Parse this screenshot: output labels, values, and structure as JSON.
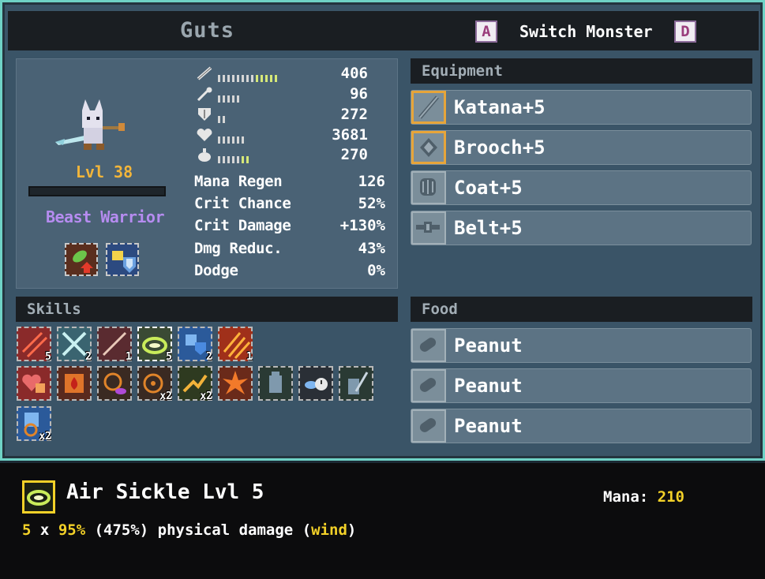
{
  "monster": {
    "name": "Guts",
    "level": "Lvl 38",
    "class": "Beast Warrior"
  },
  "switch": {
    "key_left": "A",
    "label": "Switch Monster",
    "key_right": "D"
  },
  "stats": [
    {
      "icon": "sword-icon",
      "value": "406"
    },
    {
      "icon": "staff-icon",
      "value": "96"
    },
    {
      "icon": "shield-icon",
      "value": "272"
    },
    {
      "icon": "heart-icon",
      "value": "3681"
    },
    {
      "icon": "mana-potion-icon",
      "value": "270"
    }
  ],
  "secondary_stats": [
    {
      "name": "Mana Regen",
      "value": "126"
    },
    {
      "name": "Crit Chance",
      "value": "52%"
    },
    {
      "name": "Crit Damage",
      "value": "+130%"
    },
    {
      "name": "Dmg Reduc.",
      "value": "43%"
    },
    {
      "name": "Dodge",
      "value": "0%"
    }
  ],
  "sections": {
    "equipment": "Equipment",
    "skills": "Skills",
    "food": "Food"
  },
  "equipment": [
    {
      "name": "Katana+5",
      "icon": "katana-icon"
    },
    {
      "name": "Brooch+5",
      "icon": "brooch-icon"
    },
    {
      "name": "Coat+5",
      "icon": "coat-icon"
    },
    {
      "name": "Belt+5",
      "icon": "belt-icon"
    }
  ],
  "food": [
    {
      "name": "Peanut",
      "icon": "peanut-icon"
    },
    {
      "name": "Peanut",
      "icon": "peanut-icon"
    },
    {
      "name": "Peanut",
      "icon": "peanut-icon"
    }
  ],
  "skill_counts": {
    "s1": "5",
    "s2": "2",
    "s3": "1",
    "s4": "5",
    "s5": "2",
    "s6": "1",
    "p4": "x2",
    "p5": "x2",
    "p10": "x2"
  },
  "tooltip": {
    "title": "Air Sickle Lvl 5",
    "mana_label": "Mana:",
    "mana_value": "210",
    "desc_hits": "5",
    "desc_x": "x",
    "desc_pct": "95%",
    "desc_total": "(475%) physical damage (",
    "desc_element": "wind",
    "desc_close": ")"
  },
  "colors": {
    "accent_gold": "#f3d128",
    "level": "#f2b53a",
    "class": "#b68cf0",
    "frame": "#6fd2c6"
  }
}
